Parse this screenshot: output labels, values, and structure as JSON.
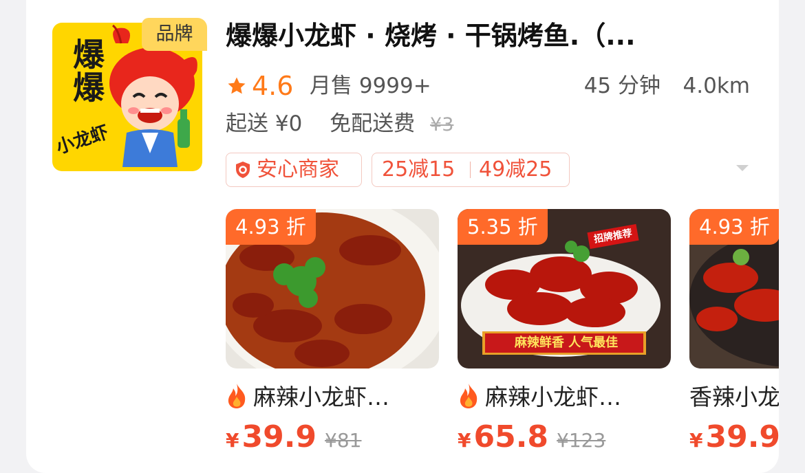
{
  "shop": {
    "brand_badge": "品牌",
    "logo_text": "爆爆",
    "logo_subtext": "小龙虾",
    "name": "爆爆小龙虾 · 烧烤 · 干锅烤鱼.（...",
    "rating": "4.6",
    "monthly_sales": "月售 9999+",
    "delivery_time": "45 分钟",
    "distance": "4.0km",
    "min_order": "起送 ¥0",
    "delivery_fee": "免配送费",
    "original_fee": "¥3",
    "tags": {
      "safe_merchant": "安心商家",
      "promo_1": "25减15",
      "promo_2": "49减25"
    }
  },
  "products": [
    {
      "discount": "4.93 折",
      "name": "麻辣小龙虾…",
      "currency": "¥",
      "price": "39.9",
      "original_price": "¥81",
      "hot_icon": "fire-icon"
    },
    {
      "discount": "5.35 折",
      "name": "麻辣小龙虾…",
      "currency": "¥",
      "price": "65.8",
      "original_price": "¥123",
      "hot_icon": "fire-icon",
      "image_caption": "麻辣鲜香  人气最佳",
      "image_badge": "招牌推荐"
    },
    {
      "discount": "4.93 折",
      "name": "香辣小龙",
      "currency": "¥",
      "price": "39.9"
    }
  ],
  "colors": {
    "accent": "#ff7a19",
    "price": "#f04a2c",
    "discount_bg": "#ff6a2a",
    "badge_bg": "#ffd65c"
  }
}
